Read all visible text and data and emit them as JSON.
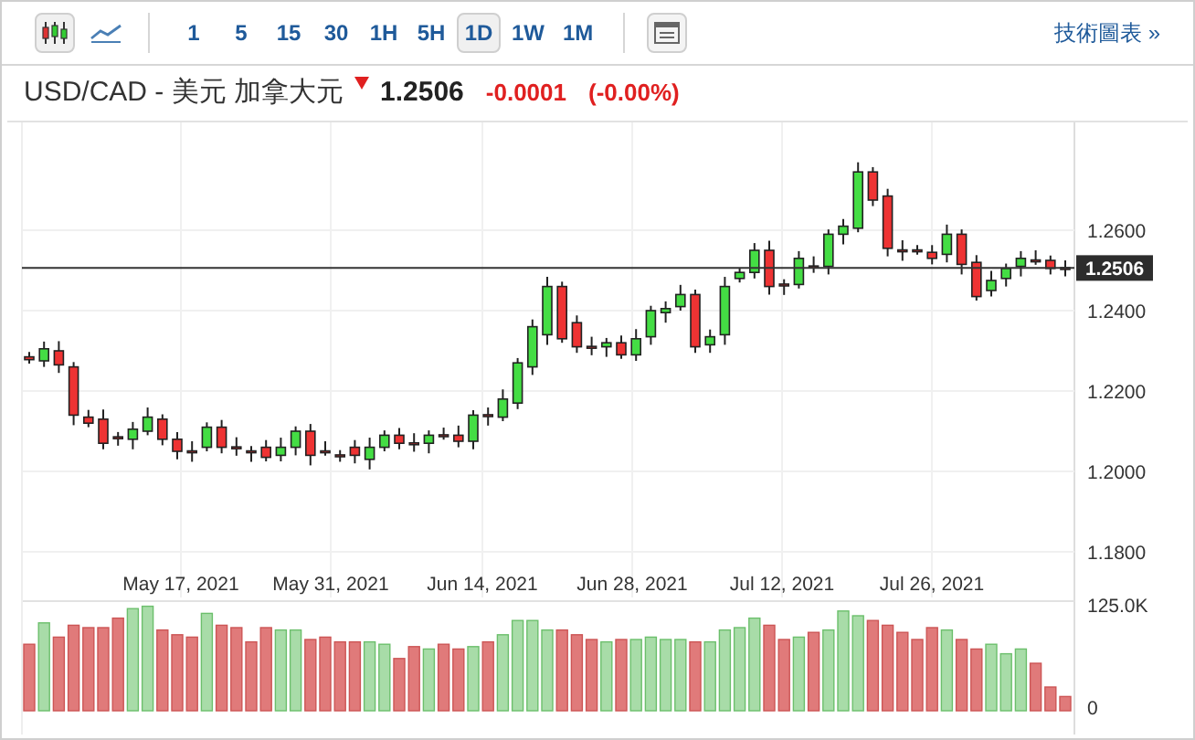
{
  "toolbar": {
    "chart_types": [
      {
        "kind": "candles",
        "selected": true
      },
      {
        "kind": "line",
        "selected": false
      }
    ],
    "intervals": [
      {
        "label": "1",
        "selected": false
      },
      {
        "label": "5",
        "selected": false
      },
      {
        "label": "15",
        "selected": false
      },
      {
        "label": "30",
        "selected": false
      },
      {
        "label": "1H",
        "selected": false
      },
      {
        "label": "5H",
        "selected": false
      },
      {
        "label": "1D",
        "selected": true
      },
      {
        "label": "1W",
        "selected": false
      },
      {
        "label": "1M",
        "selected": false
      }
    ],
    "link": "技術圖表 »"
  },
  "quote": {
    "symbol": "USD/CAD - 美元 加拿大元",
    "price": "1.2506",
    "change": "-0.0001",
    "change_pct": "(-0.00%)"
  },
  "chart": {
    "price_ticks": [
      "1.2600",
      "1.2400",
      "1.2200",
      "1.2000",
      "1.1800"
    ],
    "current_price": "1.2506",
    "dates": [
      "May 17, 2021",
      "May 31, 2021",
      "Jun 14, 2021",
      "Jun 28, 2021",
      "Jul 12, 2021",
      "Jul 26, 2021"
    ],
    "volume_ticks": [
      "125.0K",
      "0"
    ]
  }
}
